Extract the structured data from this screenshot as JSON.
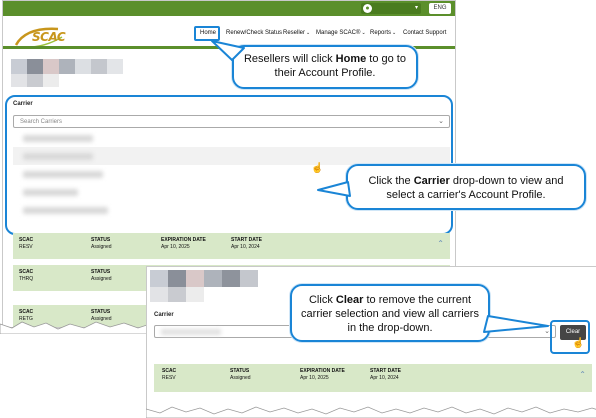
{
  "header": {
    "language": "ENG",
    "logo_text": "SCAC",
    "nav": [
      {
        "label": "Home",
        "has_caret": false
      },
      {
        "label": "Renew/Check Status",
        "has_caret": false
      },
      {
        "label": "Reseller",
        "has_caret": true
      },
      {
        "label": "Manage SCAC®",
        "has_caret": true
      },
      {
        "label": "Reports",
        "has_caret": true
      },
      {
        "label": "Contact Support",
        "has_caret": false
      }
    ]
  },
  "carrier": {
    "label": "Carrier",
    "placeholder": "Search Carriers"
  },
  "results": {
    "headers": {
      "scac": "SCAC",
      "status": "STATUS",
      "expiration": "EXPIRATION DATE",
      "start": "START DATE"
    },
    "rows": [
      {
        "scac": "RESV",
        "status": "Assigned",
        "expiration": "Apr 10, 2025",
        "start": "Apr 10, 2024"
      },
      {
        "scac": "THRQ",
        "status": "Assigned",
        "expiration": "",
        "start": ""
      },
      {
        "scac": "RETG",
        "status": "Assigned",
        "expiration": "",
        "start": ""
      }
    ]
  },
  "inset": {
    "carrier_label": "Carrier",
    "clear_label": "Clear",
    "row": {
      "scac": "RESV",
      "status": "Assigned",
      "expiration": "Apr 10, 2025",
      "start": "Apr 10, 2024"
    }
  },
  "callouts": {
    "home": {
      "pre": "Resellers will click ",
      "bold": "Home",
      "post": " to go to their Account Profile."
    },
    "carrier": {
      "pre": "Click the ",
      "bold": "Carrier",
      "post": " drop-down to view and select a carrier's Account Profile."
    },
    "clear": {
      "pre": "Click ",
      "bold": "Clear",
      "post": " to remove the current carrier selection and view all carriers in the drop-down."
    }
  },
  "colors": {
    "brand_green": "#5b8f2b",
    "highlight_blue": "#1a85d6",
    "row_green": "#d8e8c8",
    "clear_button": "#454545"
  }
}
